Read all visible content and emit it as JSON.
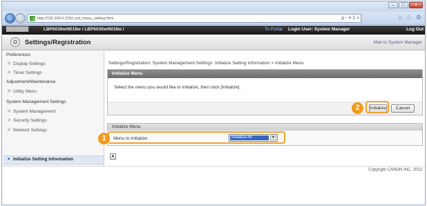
{
  "browser": {
    "url": "http://192.168.0.215/t_init_menu_setting.html",
    "address_tools": "ρ - ≡ ĉ ×",
    "win_controls": [
      "–",
      "□",
      "×"
    ]
  },
  "device_bar": {
    "host": "███████",
    "model": "LBP6030w/6018w / LBP6030w/6018w /",
    "top_portal": "To Portal",
    "login_user": "Login User: System Manager",
    "logout": "Log Out"
  },
  "header": {
    "title": "Settings/Registration",
    "mail": "Mail to System Manager"
  },
  "sidebar": {
    "preferences": "Preferences",
    "display_settings": "Display Settings",
    "timer_settings": "Timer Settings",
    "adjustment": "Adjustment/Maintenance",
    "utility_menu": "Utility Menu",
    "system_mgmt_settings": "System Management Settings",
    "system_management": "System Management",
    "security_settings": "Security Settings",
    "network_settings": "Network Settings",
    "initialize_setting_info": "Initialize Setting Information"
  },
  "main": {
    "breadcrumb": "Settings/Registration: System Management Settings: Initialize Setting Information > Initialize Menu",
    "panel1_title": "Initialize Menu",
    "instruction": "Select the menu you would like to initialize, then click [Initialize].",
    "initialize_button": "Initialize",
    "cancel_button": "Cancel",
    "panel2_title": "Initialize Menu",
    "menu_label": "Menu to Initialize:",
    "menu_value": "Initialize All",
    "badge1": "1",
    "badge2": "2",
    "top_button": "▲",
    "copyright": "Copyright CANON INC. 2013"
  },
  "colors": {
    "highlight": "#f0a12c",
    "badge": "#f39a1e",
    "panel_header": "#7a7a7a",
    "select_highlight": "#3467c2"
  }
}
